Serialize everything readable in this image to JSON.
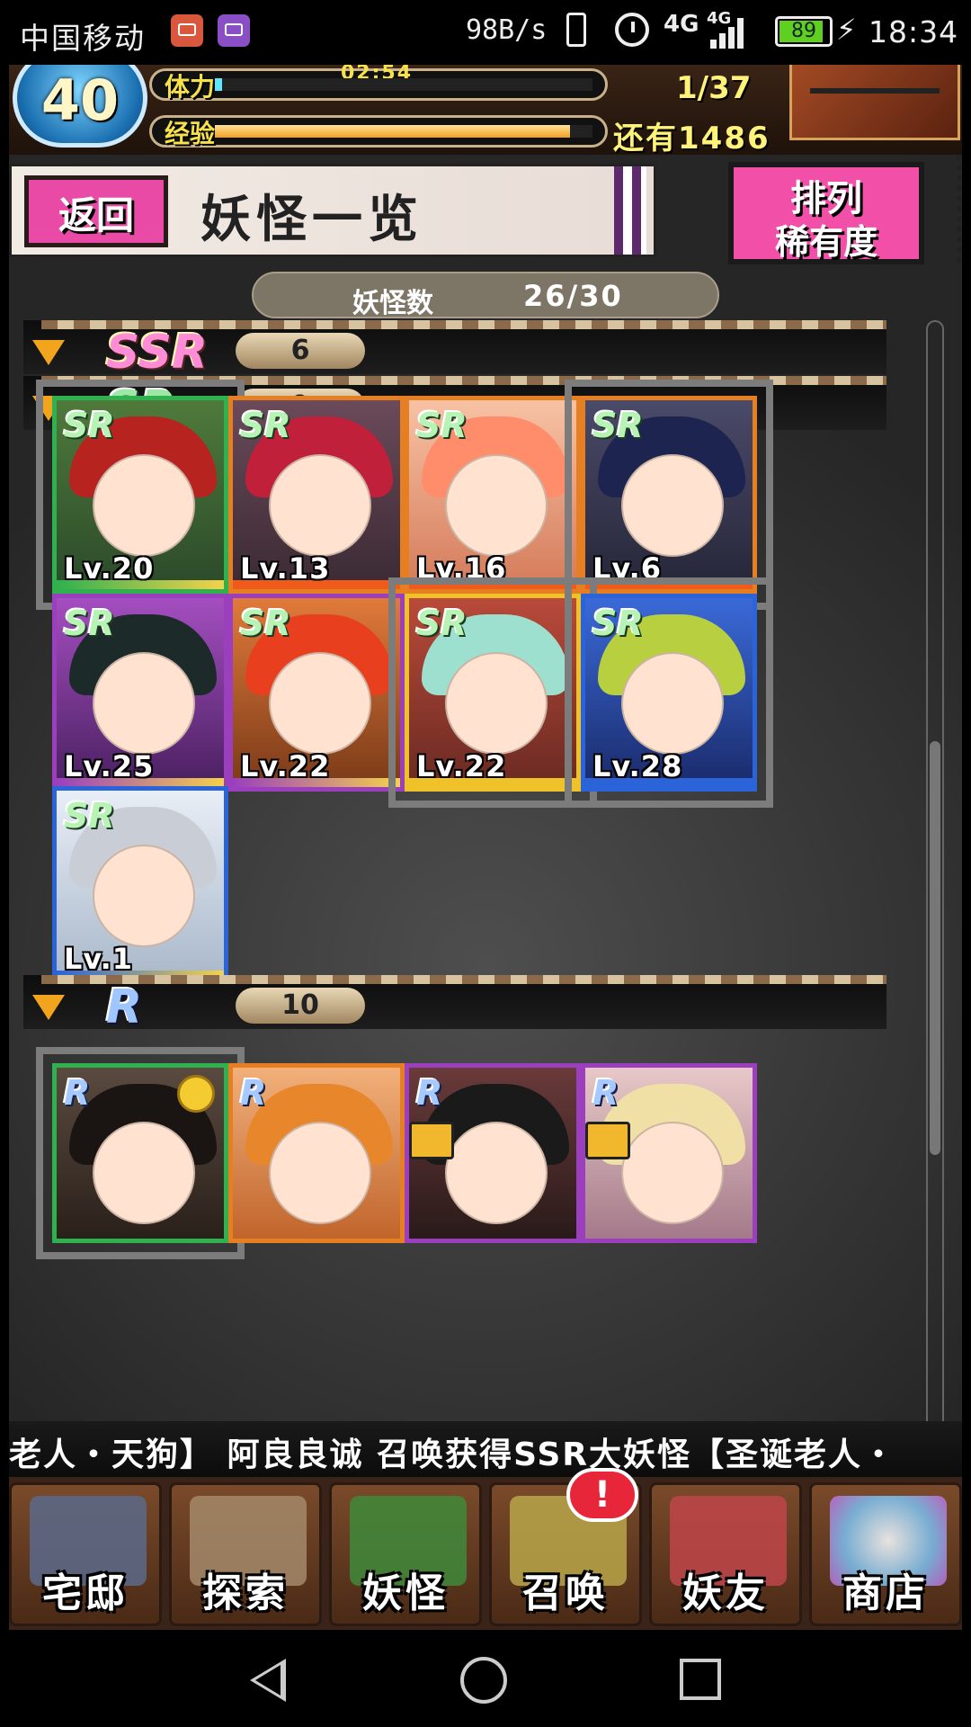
{
  "status_bar": {
    "carrier": "中国移动",
    "net_speed": "98B/s",
    "network_1": "4G",
    "network_2": "4G",
    "battery": "89",
    "time": "18:34"
  },
  "hud": {
    "level": "40",
    "stamina_label": "体力",
    "stamina_timer": "02:54",
    "stamina_fraction": 0.02,
    "stamina_count": "1/37",
    "exp_label": "经验",
    "exp_fraction": 0.94,
    "exp_remaining": "还有1486"
  },
  "header": {
    "back_label": "返回",
    "title": "妖怪一览",
    "sort_line1": "排列",
    "sort_line2": "稀有度"
  },
  "monster_count": {
    "label": "妖怪数",
    "value": "26/30"
  },
  "sections": {
    "ssr": {
      "label": "SSR",
      "count": "6"
    },
    "sr": {
      "label": "SR",
      "count": "9"
    },
    "r": {
      "label": "R",
      "count": "10"
    }
  },
  "sr_cards": [
    {
      "badge": "SR",
      "level": "Lv.20"
    },
    {
      "badge": "SR",
      "level": "Lv.13"
    },
    {
      "badge": "SR",
      "level": "Lv.16"
    },
    {
      "badge": "SR",
      "level": "Lv.6"
    },
    {
      "badge": "SR",
      "level": "Lv.25"
    },
    {
      "badge": "SR",
      "level": "Lv.22"
    },
    {
      "badge": "SR",
      "level": "Lv.22"
    },
    {
      "badge": "SR",
      "level": "Lv.28"
    },
    {
      "badge": "SR",
      "level": "Lv.1"
    }
  ],
  "r_cards": [
    {
      "badge": "R"
    },
    {
      "badge": "R"
    },
    {
      "badge": "R"
    },
    {
      "badge": "R"
    }
  ],
  "ticker": {
    "text": "老人・天狗】    阿良良诚 召唤获得SSR大妖怪【圣诞老人・"
  },
  "nav": {
    "home": "宅邸",
    "explore": "探索",
    "monsters": "妖怪",
    "summon": "召唤",
    "friends": "妖友",
    "shop": "商店",
    "summon_badge": "!"
  },
  "colors": {
    "accent_pink": "#f14fa8",
    "sr_green": "#9ee8a6",
    "orange_frame": "#e67e22",
    "exp_gold": "#f0a020"
  }
}
